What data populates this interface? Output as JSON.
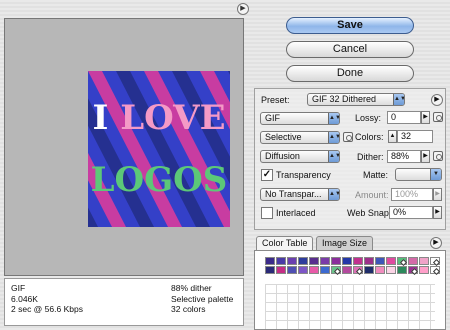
{
  "preview": {
    "image_text_line1": "I LOVE",
    "image_text_line2": "LOGOS"
  },
  "info": {
    "format": "GIF",
    "size": "6.046K",
    "speed": "2 sec @ 56.6 Kbps",
    "dither": "88% dither",
    "palette": "Selective palette",
    "colors": "32 colors"
  },
  "buttons": {
    "save": "Save",
    "cancel": "Cancel",
    "done": "Done"
  },
  "settings": {
    "preset_label": "Preset:",
    "preset_value": "GIF 32 Dithered",
    "format_value": "GIF",
    "lossy_label": "Lossy:",
    "lossy_value": "0",
    "palette_value": "Selective",
    "colors_label": "Colors:",
    "colors_value": "32",
    "dither_algo_value": "Diffusion",
    "dither_label": "Dither:",
    "dither_value": "88%",
    "transparency_label": "Transparency",
    "transparency_checked": true,
    "matte_label": "Matte:",
    "matte_value": "",
    "no_transparency_value": "No Transpar...",
    "amount_label": "Amount:",
    "amount_value": "100%",
    "interlaced_label": "Interlaced",
    "interlaced_checked": false,
    "websnap_label": "Web Snap:",
    "websnap_value": "0%"
  },
  "tabs": {
    "color_table": "Color Table",
    "image_size": "Image Size"
  },
  "palette_colors": [
    "#3b2a8a",
    "#4a3aa6",
    "#6a3fb0",
    "#2e3c9c",
    "#5a2e8e",
    "#7a3ca8",
    "#8b2f9c",
    "#2438a8",
    "#c0308e",
    "#9c2f8a",
    "#3e56b8",
    "#e04aa0",
    "#55c07a",
    "#d36aa8",
    "#f0a3c8",
    "#ffffff",
    "#2a2a78",
    "#c52e86",
    "#4f4fb2",
    "#7d56c6",
    "#e85aa8",
    "#3c6ad0",
    "#69c58a",
    "#b44a9e",
    "#dd6fb6",
    "#1f2d6a",
    "#f08cbe",
    "#fbd4e6",
    "#2c8a5c",
    "#9a3090",
    "#ff9fc9",
    "#ffffff"
  ],
  "colors_accent": {
    "image_bg": "#3440c8",
    "stripe_pink": "#d83c9c",
    "stripe_navy": "#1f2a78",
    "text_white": "#ffffff",
    "text_pink": "#f49ac6",
    "text_green": "#5cc878"
  }
}
